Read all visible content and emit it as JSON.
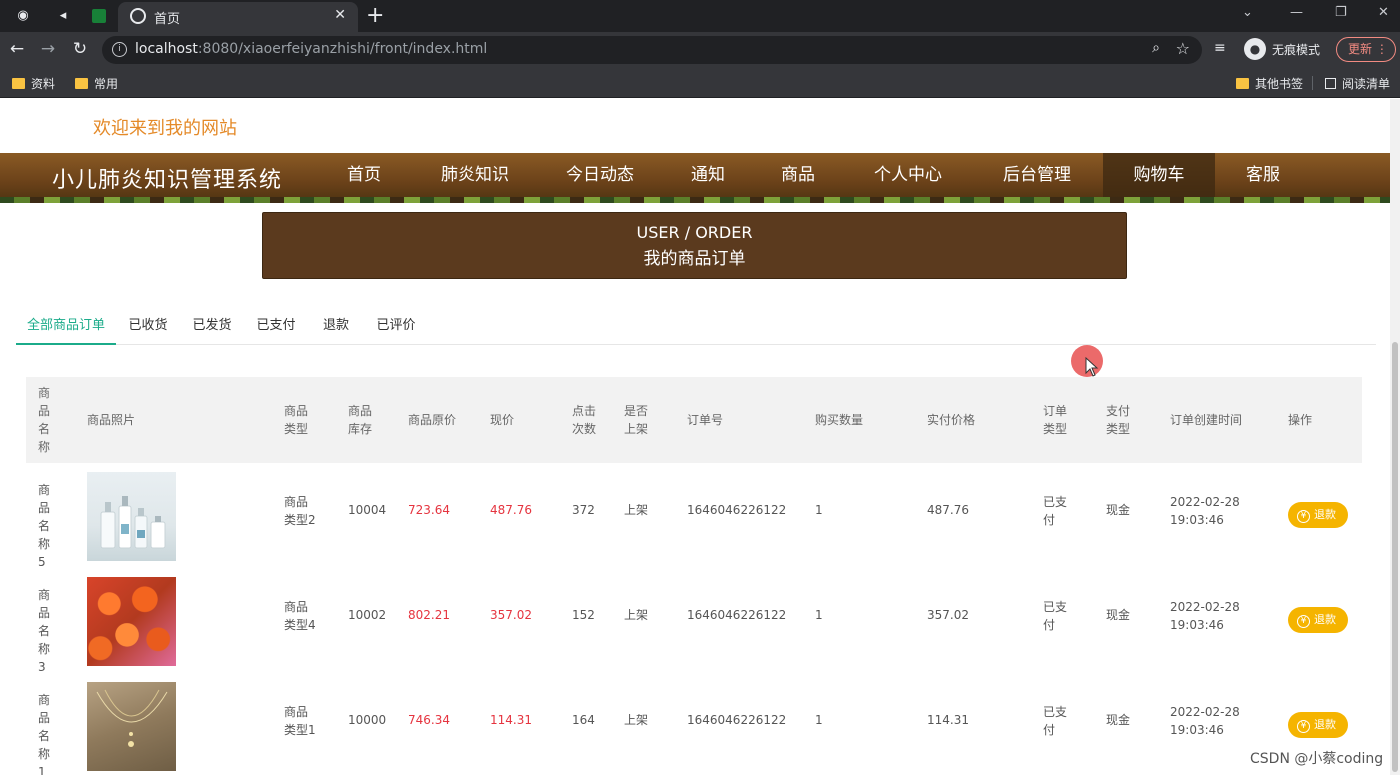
{
  "browser": {
    "tab_title": "首页",
    "url_host": "localhost",
    "url_rest": ":8080/xiaoerfeiyanzhishi/front/index.html",
    "incognito_label": "无痕模式",
    "update_label": "更新",
    "bookmarks": [
      "资料",
      "常用"
    ],
    "bookmarks_right": [
      "其他书签",
      "阅读清单"
    ]
  },
  "site": {
    "welcome": "欢迎来到我的网站",
    "brand": "小儿肺炎知识管理系统",
    "nav": [
      "首页",
      "肺炎知识",
      "今日动态",
      "通知",
      "商品",
      "个人中心",
      "后台管理",
      "购物车",
      "客服"
    ],
    "nav_active": "购物车"
  },
  "banner": {
    "en": "USER / ORDER",
    "cn": "我的商品订单"
  },
  "order_tabs": [
    "全部商品订单",
    "已收货",
    "已发货",
    "已支付",
    "退款",
    "已评价"
  ],
  "table": {
    "headers": {
      "name": "商品名称",
      "photo": "商品照片",
      "type": "商品类型",
      "stock": "商品库存",
      "orig_price": "商品原价",
      "cur_price": "现价",
      "clicks": "点击次数",
      "listed": "是否上架",
      "order_no": "订单号",
      "qty": "购买数量",
      "paid": "实付价格",
      "order_type": "订单类型",
      "pay_type": "支付类型",
      "created": "订单创建时间",
      "action": "操作"
    },
    "rows": [
      {
        "name": "商品名称5",
        "image": "bottles",
        "type": "商品类型2",
        "stock": "10004",
        "orig_price": "723.64",
        "cur_price": "487.76",
        "clicks": "372",
        "listed": "上架",
        "order_no": "1646046226122",
        "qty": "1",
        "paid": "487.76",
        "order_type": "已支付",
        "pay_type": "现金",
        "created_date": "2022-02-28",
        "created_time": "19:03:46",
        "action": "退款"
      },
      {
        "name": "商品名称3",
        "image": "flowers",
        "type": "商品类型4",
        "stock": "10002",
        "orig_price": "802.21",
        "cur_price": "357.02",
        "clicks": "152",
        "listed": "上架",
        "order_no": "1646046226122",
        "qty": "1",
        "paid": "357.02",
        "order_type": "已支付",
        "pay_type": "现金",
        "created_date": "2022-02-28",
        "created_time": "19:03:46",
        "action": "退款"
      },
      {
        "name": "商品名称1",
        "image": "necklace",
        "type": "商品类型1",
        "stock": "10000",
        "orig_price": "746.34",
        "cur_price": "114.31",
        "clicks": "164",
        "listed": "上架",
        "order_no": "1646046226122",
        "qty": "1",
        "paid": "114.31",
        "order_type": "已支付",
        "pay_type": "现金",
        "created_date": "2022-02-28",
        "created_time": "19:03:46",
        "action": "退款"
      }
    ]
  },
  "watermark": "CSDN @小蔡coding",
  "colors": {
    "nav_brown": "#6a4119",
    "banner_brown": "#5b3a1e",
    "welcome_orange": "#e48a29",
    "tab_active_green": "#1bab8a",
    "price_red": "#e5343f",
    "refund_yellow": "#f5b400"
  }
}
